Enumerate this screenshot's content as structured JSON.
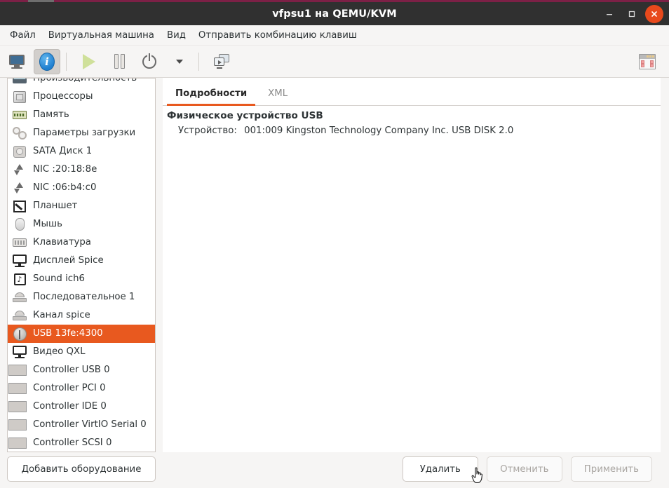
{
  "window": {
    "title": "vfpsu1 на QEMU/KVM",
    "buttons": {
      "minimize": "—",
      "maximize": "□",
      "close": "✕"
    }
  },
  "menubar": {
    "items": [
      {
        "label": "Файл"
      },
      {
        "label": "Виртуальная машина"
      },
      {
        "label": "Вид"
      },
      {
        "label": "Отправить комбинацию клавиш"
      }
    ]
  },
  "toolbar": {
    "items": [
      {
        "name": "console-view",
        "icon": "monitor-icon",
        "pressed": false
      },
      {
        "name": "details-view",
        "icon": "info-icon",
        "pressed": true
      },
      {
        "name": "run",
        "icon": "play-icon",
        "pressed": false
      },
      {
        "name": "pause",
        "icon": "pause-icon",
        "pressed": false
      },
      {
        "name": "shutdown",
        "icon": "power-icon",
        "pressed": false
      },
      {
        "name": "shutdown-menu",
        "icon": "chevron-down-icon",
        "pressed": false
      },
      {
        "name": "snapshots",
        "icon": "screens-icon",
        "pressed": false
      },
      {
        "name": "fullscreen",
        "icon": "window-icon",
        "pressed": false
      }
    ]
  },
  "sidebar": {
    "add_hardware_label": "Добавить оборудование",
    "items": [
      {
        "label": "Производительность",
        "icon": "performance-icon",
        "selected": false,
        "clipped": true
      },
      {
        "label": "Процессоры",
        "icon": "cpu-icon",
        "selected": false
      },
      {
        "label": "Память",
        "icon": "memory-icon",
        "selected": false
      },
      {
        "label": "Параметры загрузки",
        "icon": "gears-icon",
        "selected": false
      },
      {
        "label": "SATA Диск 1",
        "icon": "disk-icon",
        "selected": false
      },
      {
        "label": "NIC :20:18:8e",
        "icon": "network-icon",
        "selected": false
      },
      {
        "label": "NIC :06:b4:c0",
        "icon": "network-icon",
        "selected": false
      },
      {
        "label": "Планшет",
        "icon": "tablet-icon",
        "selected": false
      },
      {
        "label": "Мышь",
        "icon": "mouse-icon",
        "selected": false
      },
      {
        "label": "Клавиатура",
        "icon": "keyboard-icon",
        "selected": false
      },
      {
        "label": "Дисплей Spice",
        "icon": "display-icon",
        "selected": false
      },
      {
        "label": "Sound ich6",
        "icon": "sound-icon",
        "selected": false
      },
      {
        "label": "Последовательное 1",
        "icon": "serial-icon",
        "selected": false
      },
      {
        "label": "Канал spice",
        "icon": "serial-icon",
        "selected": false
      },
      {
        "label": "USB 13fe:4300",
        "icon": "usb-icon",
        "selected": true
      },
      {
        "label": "Видео QXL",
        "icon": "display-icon",
        "selected": false
      },
      {
        "label": "Controller USB 0",
        "icon": "controller-icon",
        "selected": false
      },
      {
        "label": "Controller PCI 0",
        "icon": "controller-icon",
        "selected": false
      },
      {
        "label": "Controller IDE 0",
        "icon": "controller-icon",
        "selected": false
      },
      {
        "label": "Controller VirtIO Serial 0",
        "icon": "controller-icon",
        "selected": false
      },
      {
        "label": "Controller SCSI 0",
        "icon": "controller-icon",
        "selected": false,
        "clipped": true
      }
    ]
  },
  "panel": {
    "tabs": [
      {
        "label": "Подробности",
        "active": true
      },
      {
        "label": "XML",
        "active": false
      }
    ],
    "heading": "Физическое устройство USB",
    "fields": [
      {
        "key": "Устройство:",
        "value": "001:009 Kingston Technology Company Inc. USB DISK 2.0"
      }
    ]
  },
  "footer": {
    "remove_label": "Удалить",
    "cancel_label": "Отменить",
    "apply_label": "Применить"
  },
  "colors": {
    "accent": "#e8591f",
    "titlebar": "#303030",
    "close_button": "#e8491c",
    "top_edge": "#7c2046"
  }
}
